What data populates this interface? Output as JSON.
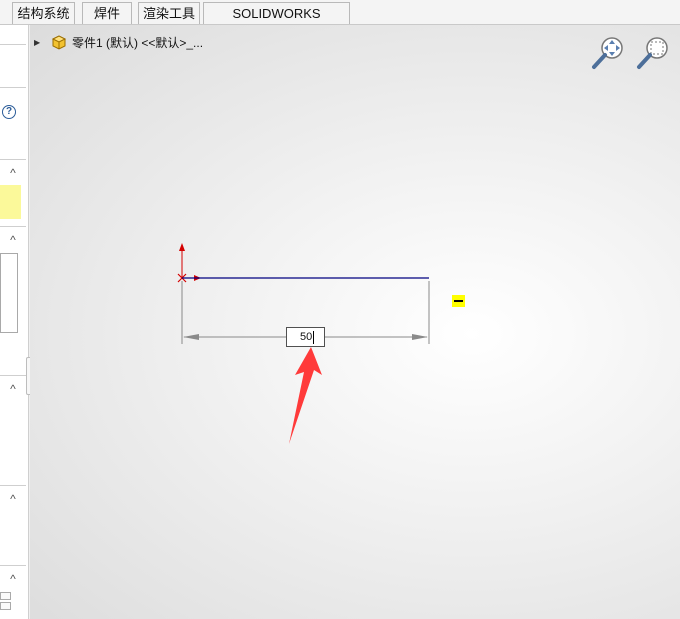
{
  "tabs": [
    {
      "label": "结构系统"
    },
    {
      "label": "焊件"
    },
    {
      "label": "渲染工具"
    },
    {
      "label": "SOLIDWORKS Inspection"
    }
  ],
  "feature_tree": {
    "expand_icon": "triangle-right-icon",
    "part_icon": "part-icon",
    "label": "零件1 (默认) <<默认>_..."
  },
  "view_tools": {
    "zoom_to_fit_icon": "zoom-to-fit-icon",
    "zoom_to_area_icon": "zoom-to-area-icon"
  },
  "left_panel": {
    "help_icon": "help-icon",
    "help_glyph": "?",
    "collapse_glyph": "^"
  },
  "sketch": {
    "line_color": "#000080",
    "origin_color": "#d40000",
    "dimension_value": "50",
    "relation_icon": "horizontal-relation-icon",
    "annotation_arrow_color": "#ff3a3a"
  }
}
